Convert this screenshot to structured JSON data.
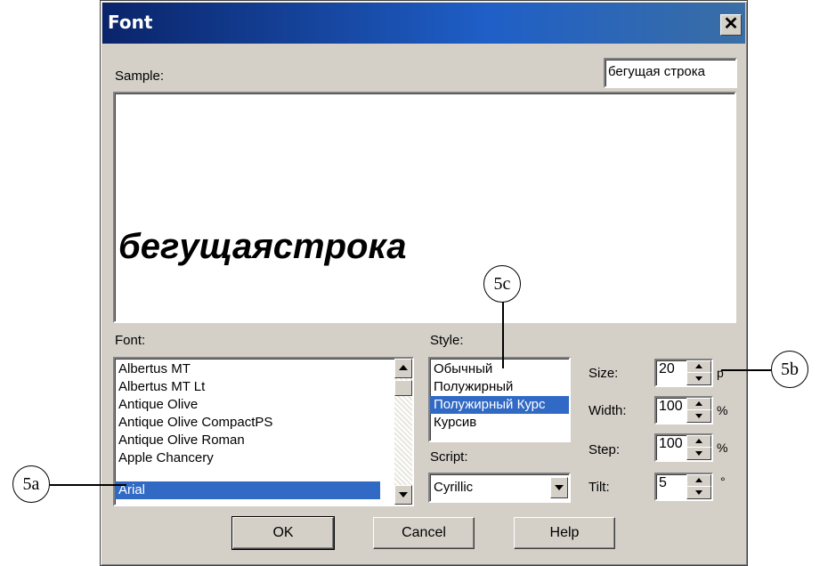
{
  "dialog": {
    "title": "Font",
    "close_symbol": "✕",
    "sample": {
      "label": "Sample:",
      "input_value": "бегущая строка",
      "preview_text": "бегущаястрока"
    },
    "font": {
      "label": "Font:",
      "items": [
        "Albertus MT",
        "Albertus MT Lt",
        "Antique Olive",
        "Antique Olive CompactPS",
        "Antique Olive Roman",
        "Apple Chancery",
        "Arial"
      ],
      "selected": "Arial"
    },
    "style": {
      "label": "Style:",
      "items": [
        "Обычный",
        "Полужирный",
        "Полужирный Курс",
        "Курсив"
      ],
      "selected": "Полужирный Курс"
    },
    "script": {
      "label": "Script:",
      "value": "Cyrillic"
    },
    "size": {
      "label": "Size:",
      "value": "20",
      "unit": "p"
    },
    "width": {
      "label": "Width:",
      "value": "100",
      "unit": "%"
    },
    "step": {
      "label": "Step:",
      "value": "100",
      "unit": "%"
    },
    "tilt": {
      "label": "Tilt:",
      "value": "5",
      "unit": "°"
    },
    "buttons": {
      "ok": "OK",
      "cancel": "Cancel",
      "help": "Help"
    }
  },
  "callouts": {
    "a": "5a",
    "b": "5b",
    "c": "5c"
  },
  "colors": {
    "title_bar": "#0a246a",
    "selection": "#316ac5",
    "face": "#d4d0c8"
  }
}
